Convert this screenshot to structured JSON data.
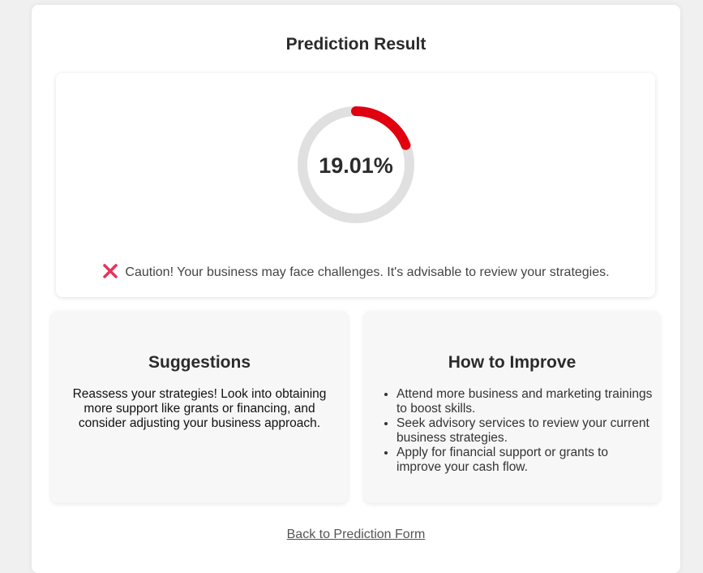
{
  "page": {
    "title": "Prediction Result"
  },
  "result": {
    "percentage_label": "19.01%",
    "percentage_value": 19.01,
    "gauge_color": "#e0000f",
    "gauge_track_color": "#e0e0e0",
    "status_icon": "cross-icon",
    "status_icon_color": "#e8335a",
    "caution_bold": "Caution!",
    "caution_text": " Your business may face challenges. It's advisable to review your strategies."
  },
  "suggestions": {
    "heading": "Suggestions",
    "text": "Reassess your strategies! Look into obtaining more support like grants or financing, and consider adjusting your business approach."
  },
  "improve": {
    "heading": "How to Improve",
    "items": [
      "Attend more business and marketing trainings to boost skills.",
      "Seek advisory services to review your current business strategies.",
      "Apply for financial support or grants to improve your cash flow."
    ]
  },
  "footer": {
    "back_link": "Back to Prediction Form"
  }
}
